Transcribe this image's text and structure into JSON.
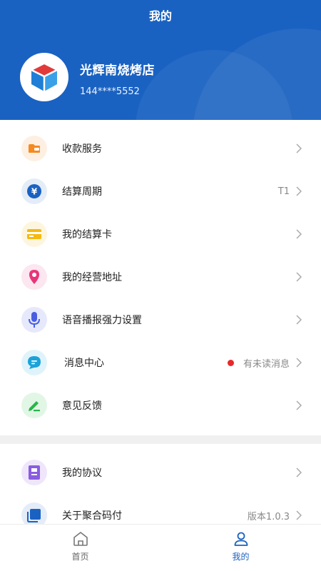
{
  "header": {
    "title": "我的",
    "shop_name": "光辉南烧烤店",
    "phone": "144****5552"
  },
  "menu": [
    {
      "label": "收款服务",
      "icon": "wallet-icon",
      "color": "#f58a1f",
      "bg": "#fdf0e2"
    },
    {
      "label": "结算周期",
      "icon": "yuan-icon",
      "color": "#1a62c2",
      "bg": "#e4ecf8",
      "value": "T1"
    },
    {
      "label": "我的结算卡",
      "icon": "card-icon",
      "color": "#f5b90f",
      "bg": "#fdf5dd"
    },
    {
      "label": "我的经营地址",
      "icon": "location-pin-icon",
      "color": "#e8357a",
      "bg": "#fce6ef"
    },
    {
      "label": "语音播报强力设置",
      "icon": "microphone-icon",
      "color": "#4a5fe0",
      "bg": "#e6e9fb"
    },
    {
      "label": "消息中心",
      "icon": "message-icon",
      "color": "#1aa3d9",
      "bg": "#e0f3fa",
      "value": "有未读消息"
    },
    {
      "label": "意见反馈",
      "icon": "feedback-icon",
      "color": "#2ab54a",
      "bg": "#e2f6e6"
    }
  ],
  "menu2": [
    {
      "label": "我的协议",
      "icon": "agreement-icon",
      "color": "#8a5ce0",
      "bg": "#efe6fb"
    },
    {
      "label": "关于聚合码付",
      "icon": "about-icon",
      "color": "#1a62c2",
      "bg": "#e4ecf8",
      "value": "版本1.0.3"
    }
  ],
  "tabs": [
    {
      "label": "首页",
      "icon": "home-icon"
    },
    {
      "label": "我的",
      "icon": "user-icon"
    }
  ],
  "colors": {
    "primary": "#1a62c2",
    "unread_dot": "#e8282b"
  }
}
